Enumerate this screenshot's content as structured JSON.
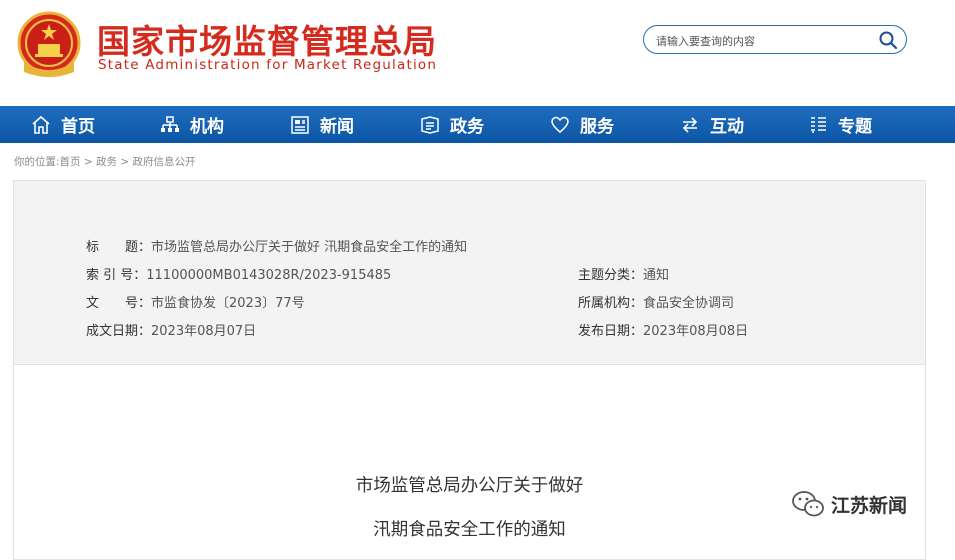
{
  "header": {
    "title": "国家市场监督管理总局",
    "subtitle": "State Administration for Market Regulation"
  },
  "search": {
    "placeholder": "请输入要查询的内容"
  },
  "nav": {
    "items": [
      {
        "label": "首页",
        "icon": "home-icon"
      },
      {
        "label": "机构",
        "icon": "org-icon"
      },
      {
        "label": "新闻",
        "icon": "news-icon"
      },
      {
        "label": "政务",
        "icon": "gov-affairs-icon"
      },
      {
        "label": "服务",
        "icon": "heart-icon"
      },
      {
        "label": "互动",
        "icon": "exchange-icon"
      },
      {
        "label": "专题",
        "icon": "topic-list-icon"
      }
    ]
  },
  "breadcrumb": {
    "prefix": "你的位置:",
    "items": [
      "首页",
      "政务",
      "政府信息公开"
    ],
    "separator": " > "
  },
  "meta": {
    "title_label": "标　　题：",
    "title_value": "市场监管总局办公厅关于做好 汛期食品安全工作的通知",
    "index_label": "索 引 号：",
    "index_value": "11100000MB0143028R/2023-915485",
    "category_label": "主题分类：",
    "category_value": "通知",
    "docno_label": "文　　号：",
    "docno_value": "市监食协发〔2023〕77号",
    "agency_label": "所属机构：",
    "agency_value": "食品安全协调司",
    "created_label": "成文日期：",
    "created_value": "2023年08月07日",
    "published_label": "发布日期：",
    "published_value": "2023年08月08日"
  },
  "document": {
    "title_line1": "市场监管总局办公厅关于做好",
    "title_line2": "汛期食品安全工作的通知"
  },
  "watermark": {
    "text": "江苏新闻"
  },
  "colors": {
    "brand_red": "#d42b1e",
    "nav_blue": "#1560b0"
  }
}
